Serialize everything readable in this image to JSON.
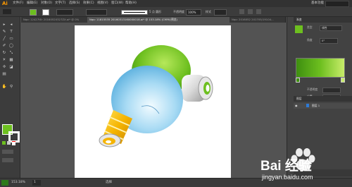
{
  "app": {
    "logo": "Ai"
  },
  "menubar": {
    "items": [
      "文件(F)",
      "编辑(E)",
      "对象(O)",
      "文字(T)",
      "选择(S)",
      "效果(C)",
      "视图(V)",
      "窗口(W)",
      "帮助(H)"
    ],
    "workspace": "基本功能"
  },
  "control_bar": {
    "opacity_label": "不透明度",
    "opacity_value": "100%",
    "style_label": "样式",
    "stroke_size": "5 点 圆形"
  },
  "tabs": [
    {
      "label": "Nqo: 12427tEr 20160520327ZX.ai* @ 0%"
    },
    {
      "label": "Nqo: 11815535 20160313160000018.ai* @ 153.18% (CMYK/预览)",
      "active": true
    },
    {
      "label": "Nqo: 2016052 201705/19104..."
    }
  ],
  "tools": [
    "▸",
    "◂",
    "✎",
    "T",
    "╱",
    "▭",
    "✐",
    "◯",
    "↻",
    "⤡",
    "☀",
    "▦",
    "✢",
    "◪",
    "▤",
    "✋",
    "⚲"
  ],
  "gradient_panel": {
    "tab_label": "渐变",
    "type_label": "类型",
    "type_value": "线性",
    "angle_label": "角度",
    "angle_value": "0°",
    "opacity_label": "不透明度",
    "position_label": "位置"
  },
  "layers_panel": {
    "tab_label": "图层",
    "layer_name": "图层 1"
  },
  "status": {
    "zoom": "153.18%",
    "page": "1",
    "mode": "选择"
  },
  "watermark": {
    "text": "Bai 经验",
    "url": "jingyan.baidu.com"
  },
  "colors": {
    "accent_green": "#6dbf1f",
    "bulb_blue": "#5bb0e0",
    "socket_yellow": "#f5b400"
  }
}
